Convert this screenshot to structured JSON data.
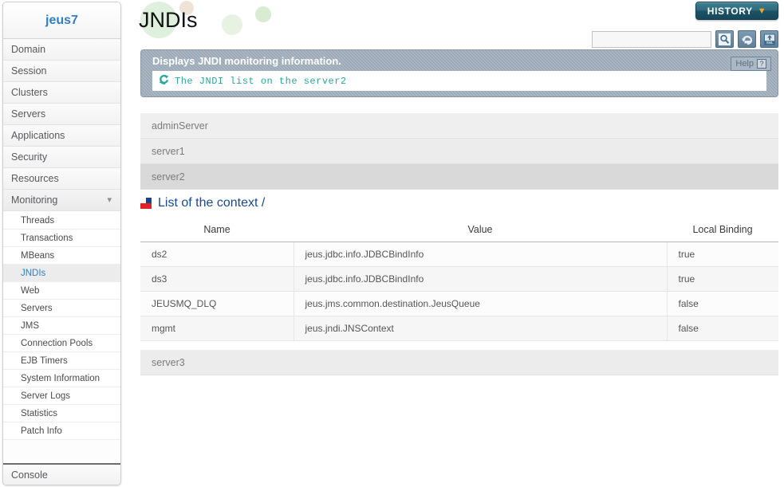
{
  "sidebar": {
    "brand": "jeus7",
    "items": [
      {
        "label": "Domain"
      },
      {
        "label": "Session"
      },
      {
        "label": "Clusters"
      },
      {
        "label": "Servers"
      },
      {
        "label": "Applications"
      },
      {
        "label": "Security"
      },
      {
        "label": "Resources"
      },
      {
        "label": "Monitoring",
        "expanded": true,
        "chevron": "chevron-down-icon"
      }
    ],
    "subitems": [
      {
        "label": "Threads"
      },
      {
        "label": "Transactions"
      },
      {
        "label": "MBeans"
      },
      {
        "label": "JNDIs",
        "active": true
      },
      {
        "label": "Web"
      },
      {
        "label": "Servers"
      },
      {
        "label": "JMS"
      },
      {
        "label": "Connection Pools"
      },
      {
        "label": "EJB Timers"
      },
      {
        "label": "System Information"
      },
      {
        "label": "Server Logs"
      },
      {
        "label": "Statistics"
      },
      {
        "label": "Patch Info"
      }
    ],
    "footer": "Console"
  },
  "header": {
    "title": "JNDIs",
    "history_label": "HISTORY",
    "history_chevron": "chevron-down-icon",
    "search_value": "",
    "search_placeholder": "",
    "tools": [
      {
        "name": "search-icon"
      },
      {
        "name": "refresh-icon"
      },
      {
        "name": "xml-export-icon"
      }
    ]
  },
  "info": {
    "title": "Displays JNDI monitoring information.",
    "status_icon": "refresh-icon",
    "status_text": "The JNDI list on the server2",
    "help_label": "Help",
    "help_icon": "question-mark-icon"
  },
  "servers": [
    {
      "label": "adminServer",
      "selected": false
    },
    {
      "label": "server1",
      "selected": false
    },
    {
      "label": "server2",
      "selected": true
    }
  ],
  "section": {
    "icon": "square-quadrant-icon",
    "title": "List of the context /"
  },
  "table": {
    "columns": [
      "Name",
      "Value",
      "Local Binding"
    ],
    "rows": [
      [
        "ds2",
        "jeus.jdbc.info.JDBCBindInfo",
        "true"
      ],
      [
        "ds3",
        "jeus.jdbc.info.JDBCBindInfo",
        "true"
      ],
      [
        "JEUSMQ_DLQ",
        "jeus.jms.common.destination.JeusQueue",
        "false"
      ],
      [
        "mgmt",
        "jeus.jndi.JNSContext",
        "false"
      ]
    ]
  },
  "server_last": {
    "label": "server3"
  },
  "colors": {
    "brand": "#2f7fc2",
    "section_title": "#184a8a",
    "info_panel": "#9aa8b6",
    "info_text": "#2aa79b",
    "history_bg": "#1d5466",
    "history_chevron": "#f5a623"
  }
}
